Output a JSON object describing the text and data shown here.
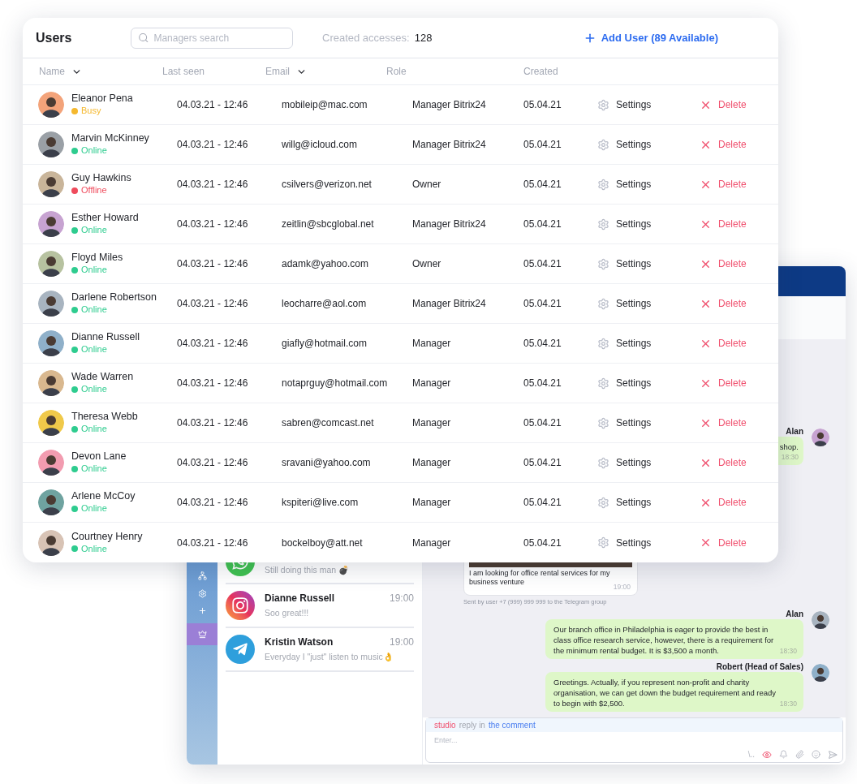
{
  "users_panel": {
    "title": "Users",
    "search": {
      "placeholder": "Managers search"
    },
    "accesses_label": "Created accesses:",
    "accesses_count": "128",
    "add_button": "Add User (89 Available)",
    "columns": [
      {
        "label": "Name",
        "sort": true
      },
      {
        "label": "Last seen",
        "sort": false
      },
      {
        "label": "Email",
        "sort": true
      },
      {
        "label": "Role",
        "sort": false
      },
      {
        "label": "Created",
        "sort": false
      }
    ],
    "rows": [
      {
        "name": "Eleanor Pena",
        "status": "Busy",
        "color": "#f5b82e",
        "last_seen": "04.03.21 - 12:46",
        "email": "mobileip@mac.com",
        "role": "Manager Bitrix24",
        "created": "05.04.21",
        "settings": "Settings",
        "delete": "Delete"
      },
      {
        "name": "Marvin McKinney",
        "status": "Online",
        "color": "#2ecc8f",
        "last_seen": "04.03.21 - 12:46",
        "email": "willg@icloud.com",
        "role": "Manager Bitrix24",
        "created": "05.04.21",
        "settings": "Settings",
        "delete": "Delete"
      },
      {
        "name": "Guy Hawkins",
        "status": "Offline",
        "color": "#ef4b5c",
        "last_seen": "04.03.21 - 12:46",
        "email": "csilvers@verizon.net",
        "role": "Owner",
        "created": "05.04.21",
        "settings": "Settings",
        "delete": "Delete"
      },
      {
        "name": "Esther Howard",
        "status": "Online",
        "color": "#2ecc8f",
        "last_seen": "04.03.21 - 12:46",
        "email": "zeitlin@sbcglobal.net",
        "role": "Manager Bitrix24",
        "created": "05.04.21",
        "settings": "Settings",
        "delete": "Delete"
      },
      {
        "name": "Floyd Miles",
        "status": "Online",
        "color": "#2ecc8f",
        "last_seen": "04.03.21 - 12:46",
        "email": "adamk@yahoo.com",
        "role": "Owner",
        "created": "05.04.21",
        "settings": "Settings",
        "delete": "Delete"
      },
      {
        "name": "Darlene Robertson",
        "status": "Online",
        "color": "#2ecc8f",
        "last_seen": "04.03.21 - 12:46",
        "email": "leocharre@aol.com",
        "role": "Manager Bitrix24",
        "created": "05.04.21",
        "settings": "Settings",
        "delete": "Delete"
      },
      {
        "name": "Dianne Russell",
        "status": "Online",
        "color": "#2ecc8f",
        "last_seen": "04.03.21 - 12:46",
        "email": "giafly@hotmail.com",
        "role": "Manager",
        "created": "05.04.21",
        "settings": "Settings",
        "delete": "Delete"
      },
      {
        "name": "Wade Warren",
        "status": "Online",
        "color": "#2ecc8f",
        "last_seen": "04.03.21 - 12:46",
        "email": "notaprguy@hotmail.com",
        "role": "Manager",
        "created": "05.04.21",
        "settings": "Settings",
        "delete": "Delete"
      },
      {
        "name": "Theresa Webb",
        "status": "Online",
        "color": "#2ecc8f",
        "last_seen": "04.03.21 - 12:46",
        "email": "sabren@comcast.net",
        "role": "Manager",
        "created": "05.04.21",
        "settings": "Settings",
        "delete": "Delete"
      },
      {
        "name": "Devon Lane",
        "status": "Online",
        "color": "#2ecc8f",
        "last_seen": "04.03.21 - 12:46",
        "email": "sravani@yahoo.com",
        "role": "Manager",
        "created": "05.04.21",
        "settings": "Settings",
        "delete": "Delete"
      },
      {
        "name": "Arlene McCoy",
        "status": "Online",
        "color": "#2ecc8f",
        "last_seen": "04.03.21 - 12:46",
        "email": "kspiteri@live.com",
        "role": "Manager",
        "created": "05.04.21",
        "settings": "Settings",
        "delete": "Delete"
      },
      {
        "name": "Courtney Henry",
        "status": "Online",
        "color": "#2ecc8f",
        "last_seen": "04.03.21 - 12:46",
        "email": "bockelboy@att.net",
        "role": "Manager",
        "created": "05.04.21",
        "settings": "Settings",
        "delete": "Delete"
      }
    ]
  },
  "chat_window": {
    "conversations": [
      {
        "kind": "whatsapp",
        "preview": "Still doing this man 💣"
      },
      {
        "kind": "instagram",
        "name": "Dianne Russell",
        "time": "19:00",
        "preview": "Soo great!!!"
      },
      {
        "kind": "telegram",
        "name": "Kristin Watson",
        "time": "19:00",
        "preview": "Everyday I \"just\" listen to music👌"
      }
    ],
    "messages": [
      {
        "kind": "outgoing_partial",
        "author": "Alan",
        "text": "shop.",
        "time": "18:30"
      },
      {
        "kind": "incoming_photo",
        "text": "I am looking for office rental services for my business venture",
        "time": "19:00",
        "note": "Sent by user +7 (999) 999 999 to the Telegram group"
      },
      {
        "kind": "outgoing",
        "author": "Alan",
        "text": "Our branch office in Philadelphia is eager to provide the best in class office research service, however, there is a requirement for the minimum rental budget. It is $3,500 a month.",
        "time": "18:30"
      },
      {
        "kind": "outgoing",
        "author": "Robert (Head of Sales)",
        "text": "Greetings. Actually, if you represent non-profit and charity organisation, we can get down the budget requirement and ready to begin with $2,500.",
        "time": "18:30"
      }
    ],
    "composer": {
      "sender": "studio",
      "middle": "reply in",
      "target": "the comment",
      "placeholder": "Enter...",
      "command": "\\.."
    }
  }
}
